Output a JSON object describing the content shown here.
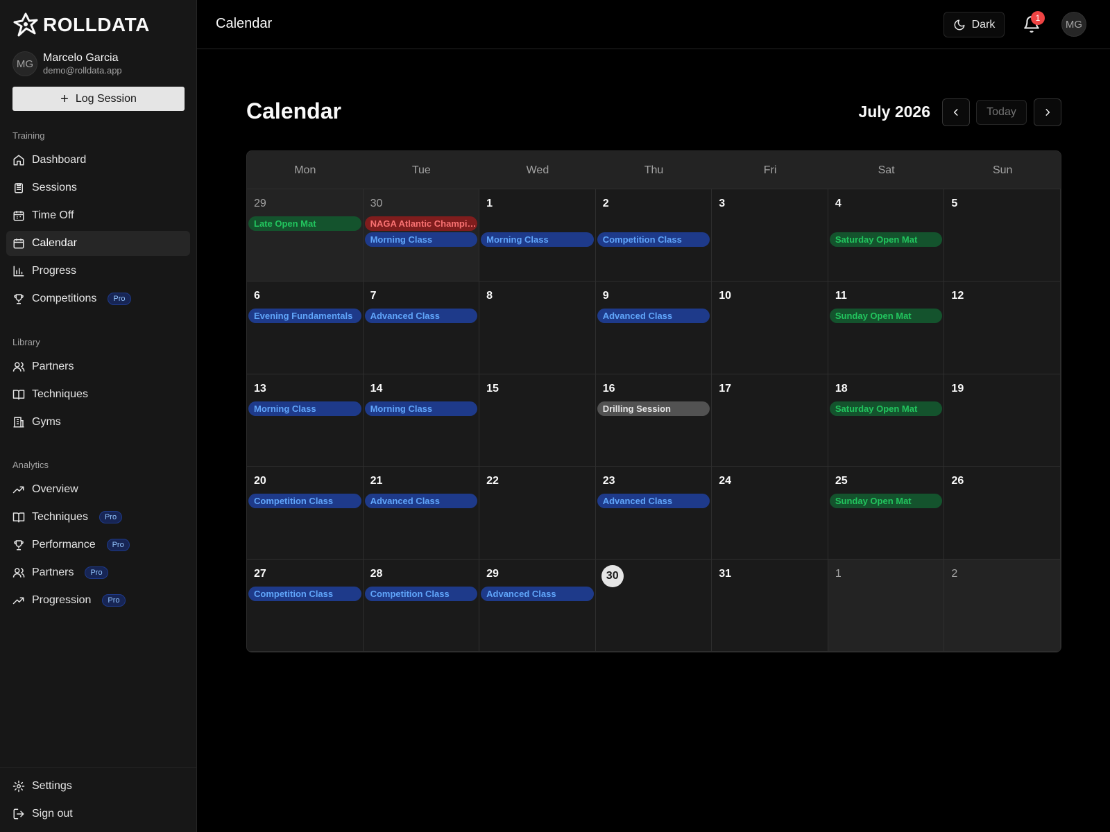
{
  "app": {
    "name": "ROLLDATA"
  },
  "user": {
    "name": "Marcelo Garcia",
    "email": "demo@rolldata.app",
    "initials": "MG"
  },
  "sidebar": {
    "log_session": "Log Session",
    "sections": {
      "training": "Training",
      "library": "Library",
      "analytics": "Analytics"
    },
    "training_items": [
      {
        "label": "Dashboard",
        "icon": "home-icon"
      },
      {
        "label": "Sessions",
        "icon": "clipboard-icon"
      },
      {
        "label": "Time Off",
        "icon": "calendar-off-icon"
      },
      {
        "label": "Calendar",
        "icon": "calendar-icon",
        "active": true
      },
      {
        "label": "Progress",
        "icon": "bar-chart-icon"
      },
      {
        "label": "Competitions",
        "icon": "trophy-icon",
        "badge": "Pro"
      }
    ],
    "library_items": [
      {
        "label": "Partners",
        "icon": "users-icon"
      },
      {
        "label": "Techniques",
        "icon": "book-icon"
      },
      {
        "label": "Gyms",
        "icon": "building-icon"
      }
    ],
    "analytics_items": [
      {
        "label": "Overview",
        "icon": "trending-icon"
      },
      {
        "label": "Techniques",
        "icon": "book-icon",
        "badge": "Pro"
      },
      {
        "label": "Performance",
        "icon": "trophy-icon",
        "badge": "Pro"
      },
      {
        "label": "Partners",
        "icon": "users-icon",
        "badge": "Pro"
      },
      {
        "label": "Progression",
        "icon": "trending-icon",
        "badge": "Pro"
      }
    ],
    "footer_items": [
      {
        "label": "Settings",
        "icon": "gear-icon"
      },
      {
        "label": "Sign out",
        "icon": "sign-out-icon"
      }
    ]
  },
  "topbar": {
    "title": "Calendar",
    "theme_label": "Dark",
    "notification_count": "1",
    "avatar_initials": "MG"
  },
  "main": {
    "title": "Calendar",
    "month": "July 2026",
    "today_label": "Today"
  },
  "calendar": {
    "weekdays": [
      "Mon",
      "Tue",
      "Wed",
      "Thu",
      "Fri",
      "Sat",
      "Sun"
    ],
    "today": 30,
    "colors": {
      "blue": "#1e3a8a",
      "green": "#14532d",
      "red": "#7f1d1d",
      "gray": "#525252"
    },
    "weeks": [
      [
        {
          "day": "29",
          "out": true,
          "events": [
            {
              "label": "Late Open Mat",
              "color": "green",
              "slot": 0
            }
          ]
        },
        {
          "day": "30",
          "out": true,
          "events": [
            {
              "label": "NAGA Atlantic Championship",
              "color": "red",
              "slot": 0
            },
            {
              "label": "Morning Class",
              "color": "blue",
              "slot": 1
            }
          ]
        },
        {
          "day": "1",
          "events": [
            {
              "label": "Morning Class",
              "color": "blue",
              "slot": 1
            }
          ]
        },
        {
          "day": "2",
          "events": [
            {
              "label": "Competition Class",
              "color": "blue",
              "slot": 1
            }
          ]
        },
        {
          "day": "3",
          "events": []
        },
        {
          "day": "4",
          "events": [
            {
              "label": "Saturday Open Mat",
              "color": "green",
              "slot": 1
            }
          ]
        },
        {
          "day": "5",
          "events": []
        }
      ],
      [
        {
          "day": "6",
          "events": [
            {
              "label": "Evening Fundamentals",
              "color": "blue",
              "slot": 0
            }
          ]
        },
        {
          "day": "7",
          "events": [
            {
              "label": "Advanced Class",
              "color": "blue",
              "slot": 0
            }
          ]
        },
        {
          "day": "8",
          "events": []
        },
        {
          "day": "9",
          "events": [
            {
              "label": "Advanced Class",
              "color": "blue",
              "slot": 0
            }
          ]
        },
        {
          "day": "10",
          "events": []
        },
        {
          "day": "11",
          "events": [
            {
              "label": "Sunday Open Mat",
              "color": "green",
              "slot": 0
            }
          ]
        },
        {
          "day": "12",
          "events": []
        }
      ],
      [
        {
          "day": "13",
          "events": [
            {
              "label": "Morning Class",
              "color": "blue",
              "slot": 0
            }
          ]
        },
        {
          "day": "14",
          "events": [
            {
              "label": "Morning Class",
              "color": "blue",
              "slot": 0
            }
          ]
        },
        {
          "day": "15",
          "events": []
        },
        {
          "day": "16",
          "events": [
            {
              "label": "Drilling Session",
              "color": "gray",
              "slot": 0
            }
          ]
        },
        {
          "day": "17",
          "events": []
        },
        {
          "day": "18",
          "events": [
            {
              "label": "Saturday Open Mat",
              "color": "green",
              "slot": 0
            }
          ]
        },
        {
          "day": "19",
          "events": []
        }
      ],
      [
        {
          "day": "20",
          "events": [
            {
              "label": "Competition Class",
              "color": "blue",
              "slot": 0
            }
          ]
        },
        {
          "day": "21",
          "events": [
            {
              "label": "Advanced Class",
              "color": "blue",
              "slot": 0
            }
          ]
        },
        {
          "day": "22",
          "events": []
        },
        {
          "day": "23",
          "events": [
            {
              "label": "Advanced Class",
              "color": "blue",
              "slot": 0
            }
          ]
        },
        {
          "day": "24",
          "events": []
        },
        {
          "day": "25",
          "events": [
            {
              "label": "Sunday Open Mat",
              "color": "green",
              "slot": 0
            }
          ]
        },
        {
          "day": "26",
          "events": []
        }
      ],
      [
        {
          "day": "27",
          "events": [
            {
              "label": "Competition Class",
              "color": "blue",
              "slot": 0
            }
          ]
        },
        {
          "day": "28",
          "events": [
            {
              "label": "Competition Class",
              "color": "blue",
              "slot": 0
            }
          ]
        },
        {
          "day": "29",
          "events": [
            {
              "label": "Advanced Class",
              "color": "blue",
              "slot": 0
            }
          ]
        },
        {
          "day": "30",
          "today": true,
          "events": []
        },
        {
          "day": "31",
          "events": []
        },
        {
          "day": "1",
          "out": true,
          "events": []
        },
        {
          "day": "2",
          "out": true,
          "events": []
        }
      ]
    ]
  }
}
